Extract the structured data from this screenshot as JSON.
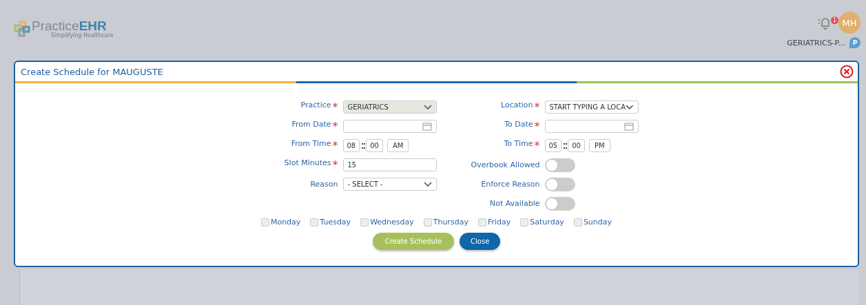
{
  "header": {
    "logo": {
      "name": "Practice",
      "accent": "EHR",
      "tagline": "Simplifying Healthcare"
    },
    "notification_count": "1",
    "avatar": "MH",
    "practice": "GERIATRICS-P...",
    "pin": "P"
  },
  "dialog": {
    "title": "Create Schedule for MAUGUSTE",
    "left_fields": [
      {
        "kind": "select",
        "label": "Practice",
        "required_mark": "*",
        "value": "GERIATRICS",
        "disabled": true
      },
      {
        "kind": "date",
        "label": "From Date",
        "required_mark": "*"
      },
      {
        "kind": "time",
        "label": "From Time",
        "required_mark": "*",
        "hour": "08",
        "minute": "00",
        "period": "AM"
      },
      {
        "kind": "text",
        "label": "Slot Minutes",
        "required_mark": "*",
        "value": "15"
      },
      {
        "kind": "select",
        "label": "Reason",
        "value": "- SELECT -",
        "disabled": false
      }
    ],
    "right_fields": [
      {
        "kind": "select",
        "label": "Location",
        "required_mark": "*",
        "value": "START TYPING A LOCA",
        "disabled": false
      },
      {
        "kind": "date",
        "label": "To Date",
        "required_mark": "*"
      },
      {
        "kind": "time",
        "label": "To Time",
        "required_mark": "*",
        "hour": "05",
        "minute": "00",
        "period": "PM"
      },
      {
        "kind": "toggle",
        "label": "Overbook Allowed",
        "on": false
      },
      {
        "kind": "toggle",
        "label": "Enforce Reason",
        "on": false
      },
      {
        "kind": "toggle",
        "label": "Not Available",
        "on": false
      }
    ],
    "days": [
      {
        "label": "Monday",
        "checked": false
      },
      {
        "label": "Tuesday",
        "checked": false
      },
      {
        "label": "Wednesday",
        "checked": false
      },
      {
        "label": "Thursday",
        "checked": false
      },
      {
        "label": "Friday",
        "checked": false
      },
      {
        "label": "Saturday",
        "checked": false
      },
      {
        "label": "Sunday",
        "checked": false
      }
    ],
    "buttons": [
      {
        "label": "Create Schedule",
        "kind": "primary"
      },
      {
        "label": "Close",
        "kind": "secondary"
      }
    ]
  }
}
